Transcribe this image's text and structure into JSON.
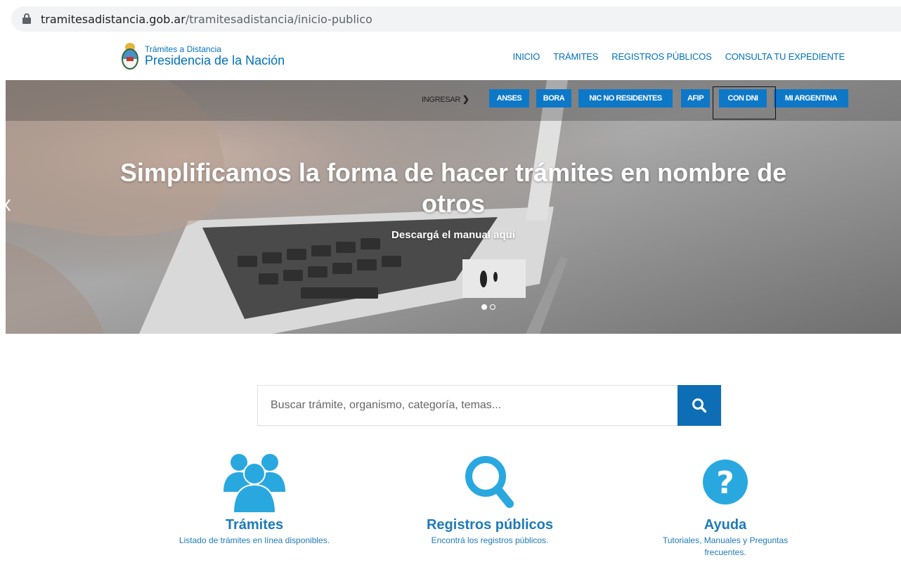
{
  "browser": {
    "url_domain": "tramitesadistancia.gob.ar",
    "url_path": "/tramitesadistancia/inicio-publico"
  },
  "header": {
    "logo_line1": "Trámites a Distancia",
    "logo_line2": "Presidencia de la Nación",
    "nav": [
      "INICIO",
      "TRÁMITES",
      "REGISTROS PÚBLICOS",
      "CONSULTA TU EXPEDIENTE"
    ]
  },
  "hero": {
    "ingresar_label": "INGRESAR",
    "ingresar_arrow": "❯",
    "login_options": [
      "ANSES",
      "BORA",
      "NIC NO RESIDENTES",
      "AFIP",
      "CON DNI",
      "MI ARGENTINA"
    ],
    "title": "Simplificamos la forma de hacer trámites en nombre de otros",
    "subtitle": "Descargá el manual aquí",
    "slides": 2,
    "active_slide": 1
  },
  "search": {
    "placeholder": "Buscar trámite, organismo, categoría, temas..."
  },
  "features": [
    {
      "icon": "users-icon",
      "title": "Trámites",
      "desc": "Listado de trámites en línea disponibles."
    },
    {
      "icon": "search-icon",
      "title": "Registros públicos",
      "desc": "Encontrá los registros públicos."
    },
    {
      "icon": "help-icon",
      "title": "Ayuda",
      "desc": "Tutoriales, Manuales y Preguntas frecuentes."
    }
  ],
  "colors": {
    "primary": "#0072bb",
    "button": "#0d78c8",
    "feature": "#1e7ab8",
    "icon": "#29a8e0"
  }
}
